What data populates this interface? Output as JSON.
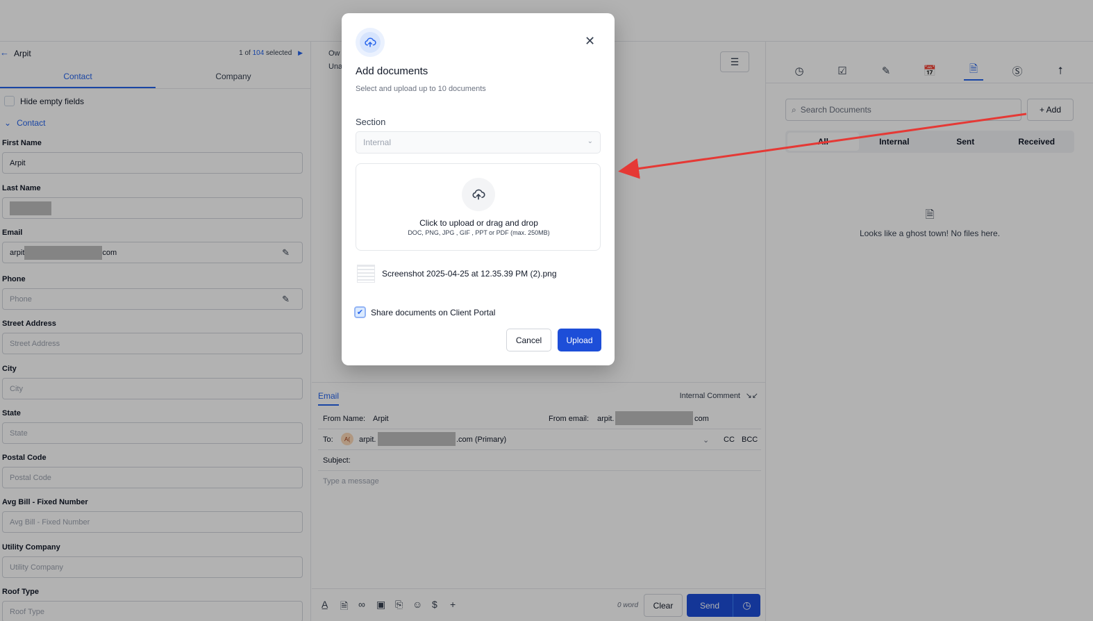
{
  "contact_panel": {
    "name": "Arpit",
    "pager_prefix": "1 of",
    "pager_total": "104",
    "pager_suffix": "selected",
    "tabs": [
      "Contact",
      "Company"
    ],
    "hide_empty_label": "Hide empty fields",
    "section_label": "Contact",
    "fields": {
      "first_name": {
        "label": "First Name",
        "value": "Arpit"
      },
      "last_name": {
        "label": "Last Name"
      },
      "email": {
        "label": "Email",
        "value_start": "arpit",
        "value_end": "com"
      },
      "phone": {
        "label": "Phone",
        "placeholder": "Phone"
      },
      "street": {
        "label": "Street Address",
        "placeholder": "Street Address"
      },
      "city": {
        "label": "City",
        "placeholder": "City"
      },
      "state": {
        "label": "State",
        "placeholder": "State"
      },
      "postal": {
        "label": "Postal Code",
        "placeholder": "Postal Code"
      },
      "avg_bill": {
        "label": "Avg Bill - Fixed Number",
        "placeholder": "Avg Bill - Fixed Number"
      },
      "utility": {
        "label": "Utility Company",
        "placeholder": "Utility Company"
      },
      "roof": {
        "label": "Roof Type",
        "placeholder": "Roof Type"
      }
    }
  },
  "middle": {
    "owner_line1": "Ow",
    "owner_line2": "Una"
  },
  "composer": {
    "tab_email": "Email",
    "internal_comment": "Internal Comment",
    "from_name_label": "From Name:",
    "from_name_value": "Arpit",
    "from_email_label": "From email:",
    "from_email_start": "arpit.",
    "from_email_end": "com",
    "to_label": "To:",
    "to_avatar": "A(",
    "to_start": "arpit.",
    "to_end": ".com (Primary)",
    "cc": "CC",
    "bcc": "BCC",
    "subject_label": "Subject:",
    "message_placeholder": "Type a message",
    "word_count": "0 word",
    "clear": "Clear",
    "send": "Send"
  },
  "documents": {
    "search_placeholder": "Search Documents",
    "add_label": "+ Add",
    "filters": [
      "All",
      "Internal",
      "Sent",
      "Received"
    ],
    "empty_text": "Looks like a ghost town! No files here."
  },
  "modal": {
    "title": "Add documents",
    "subtitle": "Select and upload up to 10 documents",
    "section_label": "Section",
    "section_value": "Internal",
    "drop_title": "Click to upload or drag and drop",
    "drop_hint": "DOC, PNG, JPG , GIF , PPT or PDF (max. 250MB)",
    "file_name": "Screenshot 2025-04-25 at 12.35.39 PM (2).png",
    "share_label": "Share documents on Client Portal",
    "share_checked": true,
    "cancel": "Cancel",
    "upload": "Upload"
  },
  "colors": {
    "accent": "#1d4ed8",
    "annotation_arrow": "#e53935"
  }
}
